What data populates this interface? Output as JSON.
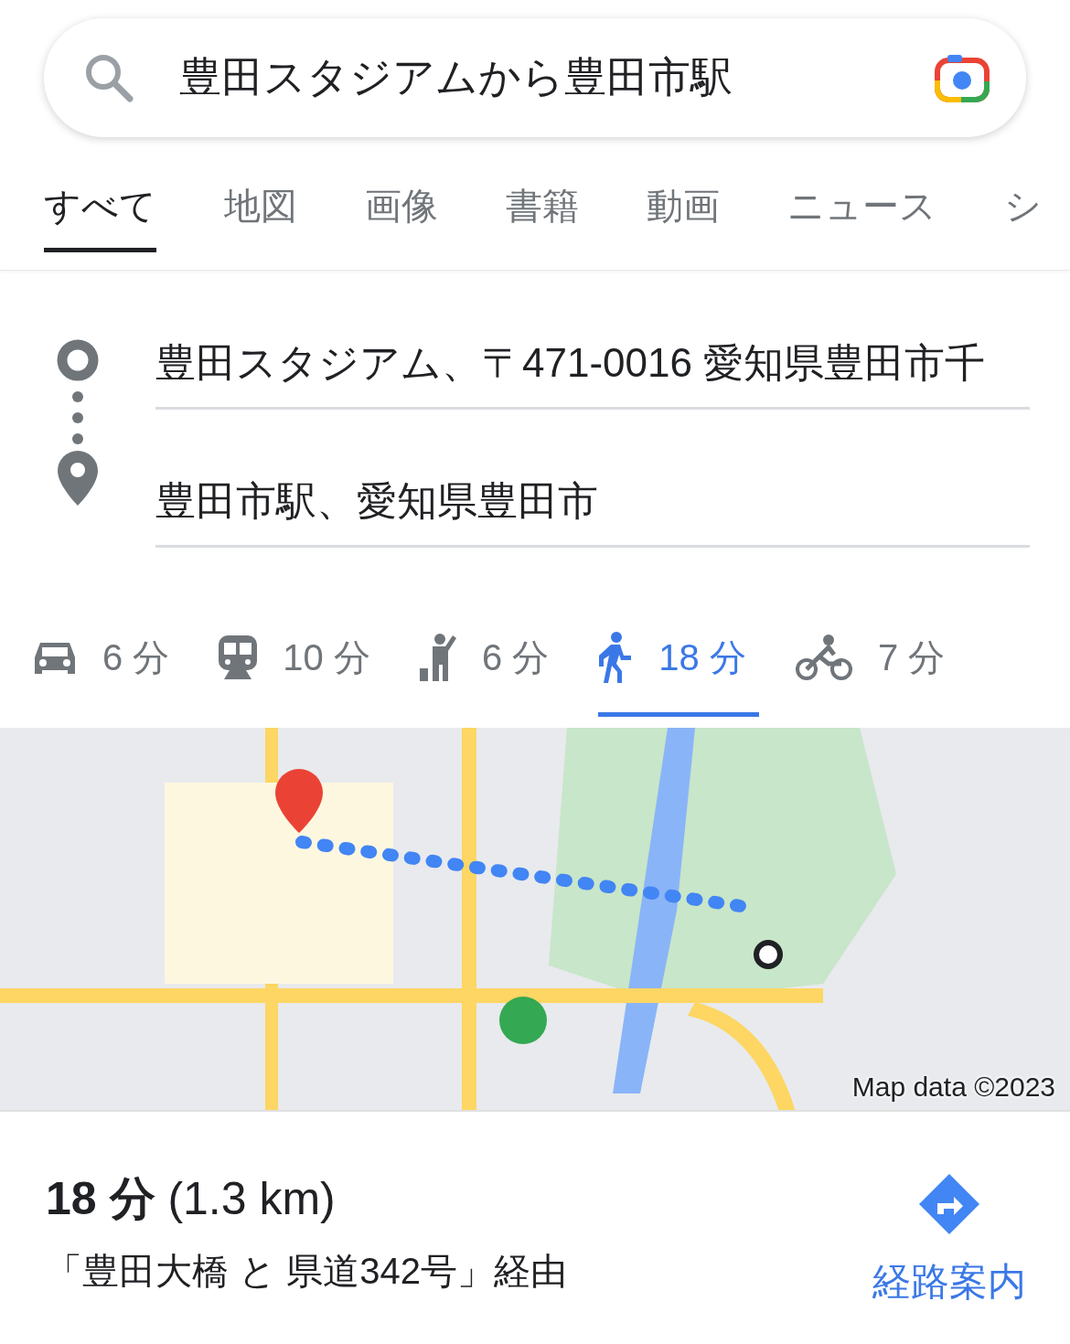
{
  "search": {
    "query": "豊田スタジアムから豊田市駅"
  },
  "tabs": [
    {
      "label": "すべて",
      "selected": true
    },
    {
      "label": "地図",
      "selected": false
    },
    {
      "label": "画像",
      "selected": false
    },
    {
      "label": "書籍",
      "selected": false
    },
    {
      "label": "動画",
      "selected": false
    },
    {
      "label": "ニュース",
      "selected": false
    },
    {
      "label": "シ",
      "selected": false
    }
  ],
  "route": {
    "origin": "豊田スタジアム、〒471-0016 愛知県豊田市千",
    "destination": "豊田市駅、愛知県豊田市"
  },
  "modes": [
    {
      "kind": "car",
      "time": "6 分",
      "selected": false
    },
    {
      "kind": "transit",
      "time": "10 分",
      "selected": false
    },
    {
      "kind": "ride",
      "time": "6 分",
      "selected": false
    },
    {
      "kind": "walk",
      "time": "18 分",
      "selected": true
    },
    {
      "kind": "bicycle",
      "time": "7 分",
      "selected": false
    }
  ],
  "map": {
    "kind": "picture",
    "attribution": "Map data ©2023"
  },
  "summary": {
    "duration": "**18 分** (1.3 km)",
    "via": "「豊田大橋 と 県道342号」経由",
    "directions_button": "経路案内"
  }
}
